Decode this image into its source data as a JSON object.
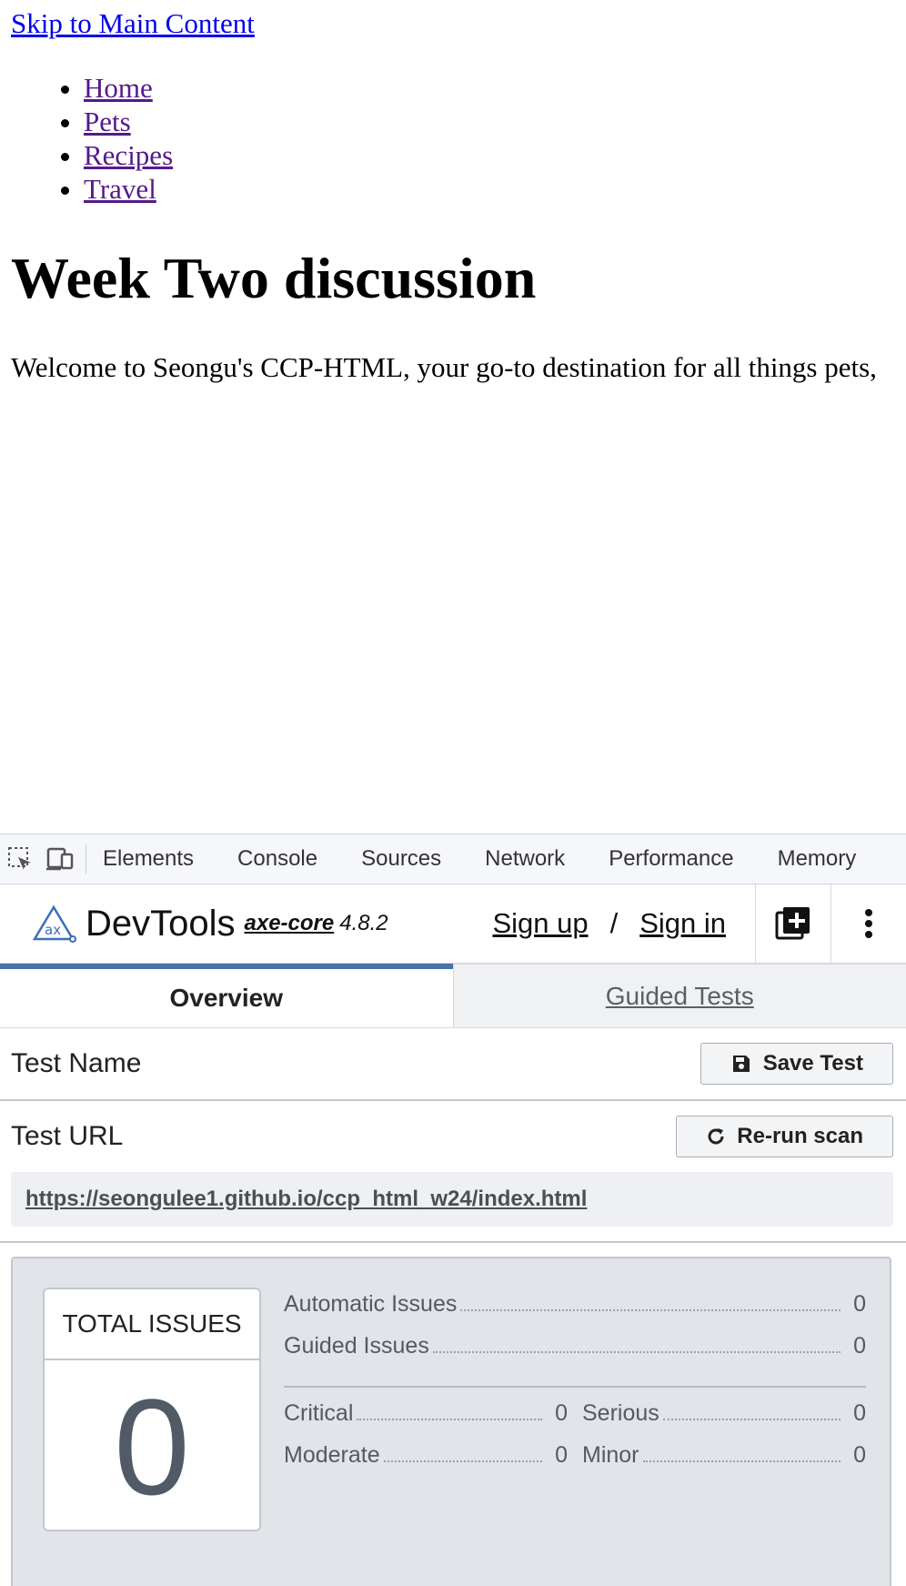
{
  "page": {
    "skip_link": "Skip to Main Content",
    "nav": [
      "Home",
      "Pets",
      "Recipes",
      "Travel"
    ],
    "heading": "Week Two discussion",
    "intro": "Welcome to Seongu's CCP-HTML, your go-to destination for all things pets,"
  },
  "devtools": {
    "tabs": [
      "Elements",
      "Console",
      "Sources",
      "Network",
      "Performance",
      "Memory"
    ],
    "axe": {
      "title": "DevTools",
      "core_label": "axe-core",
      "version": "4.8.2",
      "sign_up": "Sign up",
      "slash": "/",
      "sign_in": "Sign in",
      "tab_overview": "Overview",
      "tab_guided": "Guided Tests",
      "test_name_label": "Test Name",
      "save_test": "Save Test",
      "test_url_label": "Test URL",
      "rerun_scan": "Re-run scan",
      "url": "https://seongulee1.github.io/ccp_html_w24/index.html",
      "total_issues_label": "TOTAL ISSUES",
      "total_issues": "0",
      "automatic_issues_label": "Automatic Issues",
      "automatic_issues": "0",
      "guided_issues_label": "Guided Issues",
      "guided_issues": "0",
      "critical_label": "Critical",
      "critical": "0",
      "serious_label": "Serious",
      "serious": "0",
      "moderate_label": "Moderate",
      "moderate": "0",
      "minor_label": "Minor",
      "minor": "0"
    }
  }
}
